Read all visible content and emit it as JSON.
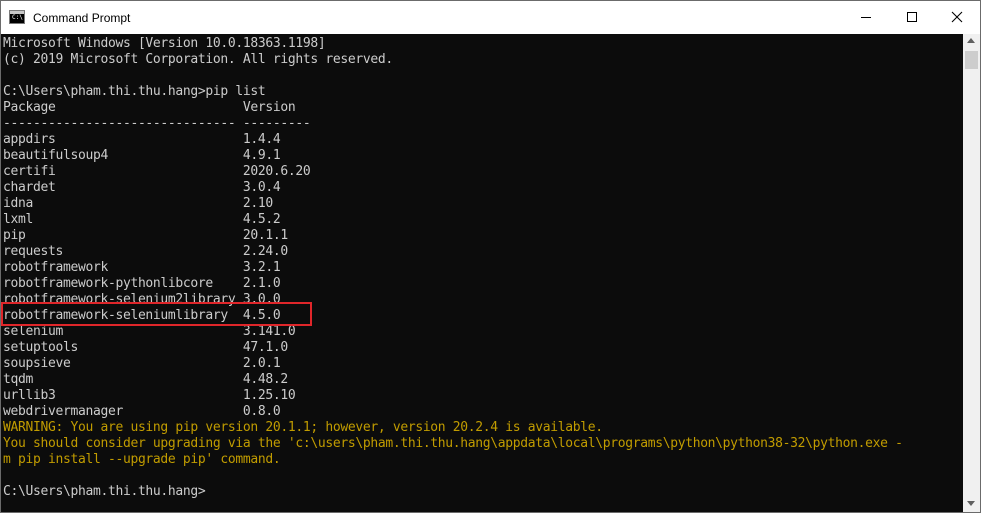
{
  "window": {
    "title": "Command Prompt",
    "icon_text": "C:\\",
    "icons": {
      "app": "cmd-icon",
      "minimize": "minimize-icon",
      "maximize": "maximize-icon",
      "close": "close-icon"
    }
  },
  "console": {
    "highlight_color": "#e0262a",
    "lines": [
      {
        "text": "Microsoft Windows [Version 10.0.18363.1198]",
        "style": "normal"
      },
      {
        "text": "(c) 2019 Microsoft Corporation. All rights reserved.",
        "style": "normal"
      },
      {
        "text": "",
        "style": "normal"
      },
      {
        "text": "C:\\Users\\pham.thi.thu.hang>pip list",
        "style": "normal"
      },
      {
        "text": "Package                         Version",
        "style": "normal"
      },
      {
        "text": "------------------------------- ---------",
        "style": "normal"
      },
      {
        "text": "appdirs                         1.4.4",
        "style": "normal"
      },
      {
        "text": "beautifulsoup4                  4.9.1",
        "style": "normal"
      },
      {
        "text": "certifi                         2020.6.20",
        "style": "normal"
      },
      {
        "text": "chardet                         3.0.4",
        "style": "normal"
      },
      {
        "text": "idna                            2.10",
        "style": "normal"
      },
      {
        "text": "lxml                            4.5.2",
        "style": "normal"
      },
      {
        "text": "pip                             20.1.1",
        "style": "normal"
      },
      {
        "text": "requests                        2.24.0",
        "style": "normal"
      },
      {
        "text": "robotframework                  3.2.1",
        "style": "normal"
      },
      {
        "text": "robotframework-pythonlibcore    2.1.0",
        "style": "normal"
      },
      {
        "text": "robotframework-selenium2library 3.0.0",
        "style": "normal"
      },
      {
        "text": "robotframework-seleniumlibrary  4.5.0",
        "style": "normal"
      },
      {
        "text": "selenium                        3.141.0",
        "style": "normal"
      },
      {
        "text": "setuptools                      47.1.0",
        "style": "normal"
      },
      {
        "text": "soupsieve                       2.0.1",
        "style": "normal"
      },
      {
        "text": "tqdm                            4.48.2",
        "style": "normal"
      },
      {
        "text": "urllib3                         1.25.10",
        "style": "normal"
      },
      {
        "text": "webdrivermanager                0.8.0",
        "style": "normal"
      },
      {
        "text": "WARNING: You are using pip version 20.1.1; however, version 20.2.4 is available.",
        "style": "warn"
      },
      {
        "text": "You should consider upgrading via the 'c:\\users\\pham.thi.thu.hang\\appdata\\local\\programs\\python\\python38-32\\python.exe -",
        "style": "warn"
      },
      {
        "text": "m pip install --upgrade pip' command.",
        "style": "warn"
      },
      {
        "text": "",
        "style": "normal"
      },
      {
        "text": "C:\\Users\\pham.thi.thu.hang>",
        "style": "normal"
      }
    ]
  }
}
